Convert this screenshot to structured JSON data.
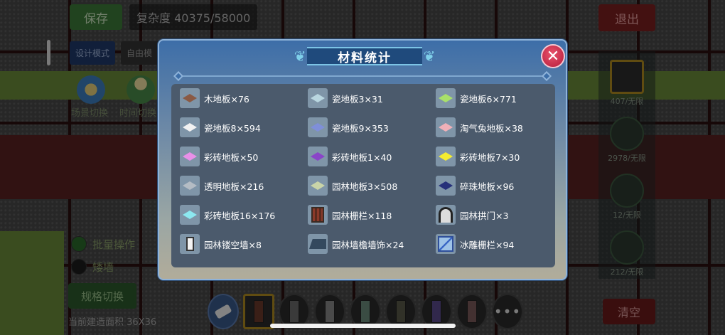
{
  "background": {
    "save_label": "保存",
    "complexity_text": "复杂度 40375/58000",
    "design_mode_label": "设计模式",
    "design_mode_value": "自由模",
    "round_buttons": [
      "场景切换",
      "时间切换"
    ],
    "exit_label": "退出",
    "right_panel": [
      "407/无限",
      "2978/无限",
      "12/无限",
      "212/无限"
    ],
    "bottom_checks": [
      {
        "label": "批量操作",
        "checked": true
      },
      {
        "label": "矮墙",
        "checked": false
      }
    ],
    "spec_switch_label": "规格切换",
    "current_build_text": "当前建造面积 36X36",
    "clear_label": "清空",
    "toolbar_more": "•••"
  },
  "dialog": {
    "title": "材料统计",
    "close_symbol": "✕",
    "items": [
      {
        "label": "木地板×76",
        "icon": "tile",
        "color": "#8a5a44"
      },
      {
        "label": "瓷地板3×31",
        "icon": "tile",
        "color": "#b9d6e0"
      },
      {
        "label": "瓷地板6×771",
        "icon": "tile",
        "color": "#a8e06a"
      },
      {
        "label": "瓷地板8×594",
        "icon": "tile",
        "color": "#f2f2f2"
      },
      {
        "label": "瓷地板9×353",
        "icon": "tile",
        "color": "#7f8fd8"
      },
      {
        "label": "淘气兔地板×38",
        "icon": "tile",
        "color": "#f0b0b8"
      },
      {
        "label": "彩砖地板×50",
        "icon": "tile",
        "color": "#e890e8"
      },
      {
        "label": "彩砖地板1×40",
        "icon": "tile",
        "color": "#8a44c8"
      },
      {
        "label": "彩砖地板7×30",
        "icon": "tile",
        "color": "#f4ec30"
      },
      {
        "label": "透明地板×216",
        "icon": "tile",
        "color": "#b4bcc4"
      },
      {
        "label": "园林地板3×508",
        "icon": "tile",
        "color": "#c9d4a8"
      },
      {
        "label": "碎珠地板×96",
        "icon": "tile",
        "color": "#26307a"
      },
      {
        "label": "彩砖地板16×176",
        "icon": "tile",
        "color": "#8ce8f0"
      },
      {
        "label": "园林栅栏×118",
        "icon": "fence",
        "color": ""
      },
      {
        "label": "园林拱门×3",
        "icon": "arch",
        "color": ""
      },
      {
        "label": "园林镂空墙×8",
        "icon": "window",
        "color": ""
      },
      {
        "label": "园林墙檐墙饰×24",
        "icon": "eave",
        "color": ""
      },
      {
        "label": "冰雕栅栏×94",
        "icon": "ice",
        "color": ""
      }
    ]
  }
}
